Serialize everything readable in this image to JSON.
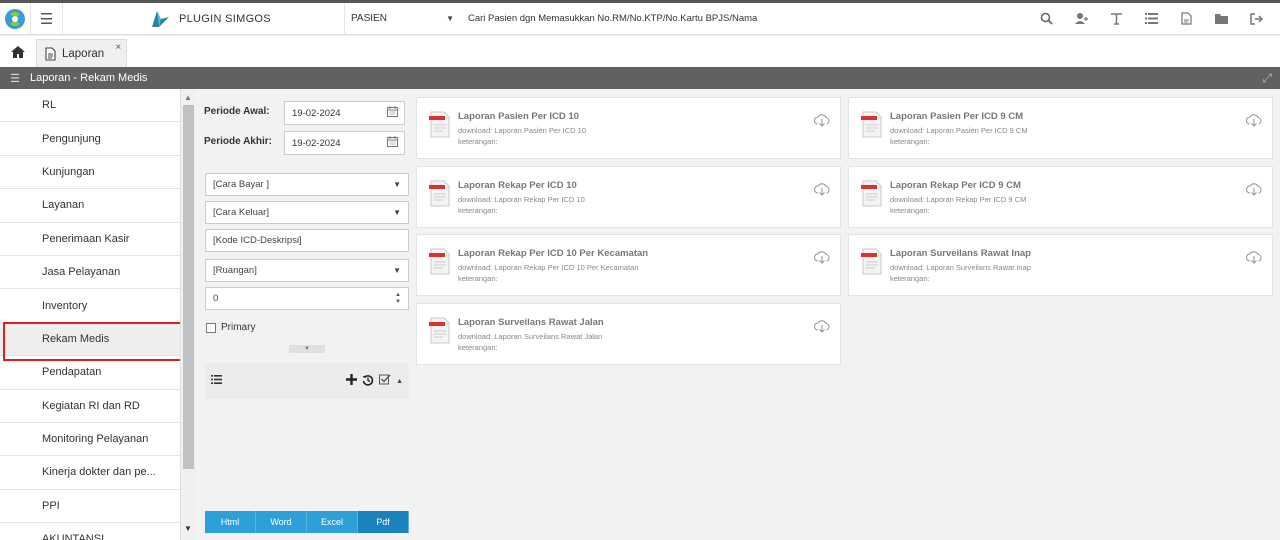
{
  "app": {
    "brand": "PLUGIN SIMGOS"
  },
  "search": {
    "category": "PASIEN",
    "placeholder": "Cari Pasien dgn Memasukkan No.RM/No.KTP/No.Kartu BPJS/Nama"
  },
  "tabs": [
    {
      "label": "Laporan",
      "close": "×"
    }
  ],
  "panel": {
    "title": "Laporan - Rekam Medis"
  },
  "nav": {
    "items": [
      "RL",
      "Pengunjung",
      "Kunjungan",
      "Layanan",
      "Penerimaan Kasir",
      "Jasa Pelayanan",
      "Inventory",
      "Rekam Medis",
      "Pendapatan",
      "Kegiatan RI dan RD",
      "Monitoring Pelayanan",
      "Kinerja dokter dan pe...",
      "PPI",
      "AKUNTANSI"
    ],
    "active": "Rekam Medis"
  },
  "filters": {
    "periode_awal_label": "Periode Awal:",
    "periode_awal": "19-02-2024",
    "periode_akhir_label": "Periode Akhir:",
    "periode_akhir": "19-02-2024",
    "cara_bayar": "[Cara Bayar ]",
    "cara_keluar": "[Cara Keluar]",
    "kode_icd": "[Kode ICD-Deskripsi]",
    "ruangan": "[Ruangan]",
    "number": "0",
    "primary_label": "Primary"
  },
  "buttons": {
    "html": "Html",
    "word": "Word",
    "excel": "Excel",
    "pdf": "Pdf",
    "active": "Pdf"
  },
  "reports": [
    {
      "title": "Laporan Pasien Per ICD 10",
      "download": "download: Laporan Pasien Per ICD 10",
      "ket": "keterangan:"
    },
    {
      "title": "Laporan Pasien Per ICD 9 CM",
      "download": "download: Laporan Pasien Per ICD 9 CM",
      "ket": "keterangan:"
    },
    {
      "title": "Laporan Rekap Per ICD 10",
      "download": "download: Laporan Rekap Per ICD 10",
      "ket": "keterangan:"
    },
    {
      "title": "Laporan Rekap Per ICD 9 CM",
      "download": "download: Laporan Rekap Per ICD 9 CM",
      "ket": "keterangan:"
    },
    {
      "title": "Laporan Rekap Per ICD 10 Per Kecamatan",
      "download": "download: Laporan Rekap Per ICD 10 Per Kecamatan",
      "ket": "keterangan:"
    },
    {
      "title": "Laporan Surveilans Rawat Inap",
      "download": "download: Laporan Surveilans Rawat Inap",
      "ket": "keterangan:"
    },
    {
      "title": "Laporan Surveilans Rawat Jalan",
      "download": "download: Laporan Surveilans Rawat Jalan",
      "ket": "keterangan:"
    }
  ],
  "colors": {
    "accent": "#2ea0d8",
    "accent_active": "#1a82bd",
    "panel_bar": "#616161",
    "highlight_border": "#e02020"
  }
}
